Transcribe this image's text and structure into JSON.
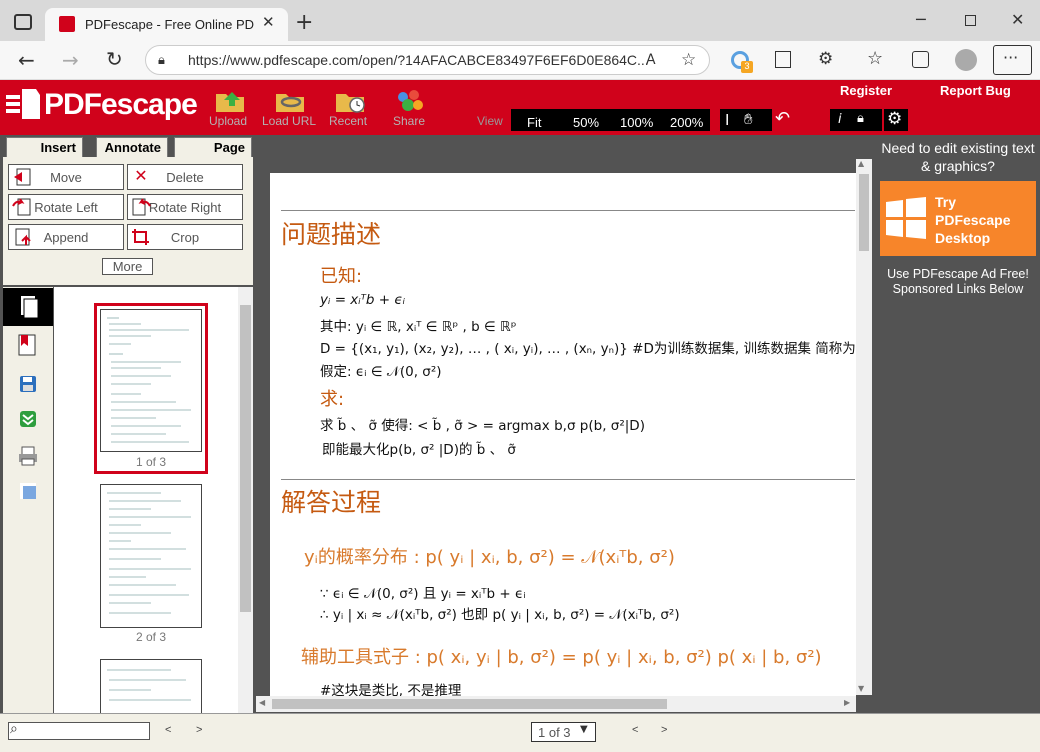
{
  "browser": {
    "tab_title": "PDFescape - Free Online PDF Edi",
    "url": "https://www.pdfescape.com/open/?14AFACABCE83497F6EF6D0E864C...",
    "extension_badge": "3"
  },
  "app": {
    "logo": "PDFescape",
    "toolbar": [
      "Upload",
      "Load URL",
      "Recent",
      "Share"
    ],
    "view_label": "View",
    "zoom_options": [
      "Fit",
      "50%",
      "100%",
      "200%"
    ],
    "register": "Register",
    "report_bug": "Report Bug",
    "info_glyph": "i"
  },
  "left": {
    "tabs": [
      "Insert",
      "Annotate",
      "Page"
    ],
    "page_tools": [
      "Move",
      "Delete",
      "Rotate Left",
      "Rotate Right",
      "Append",
      "Crop"
    ],
    "more": "More",
    "thumb_labels": [
      "1 of 3",
      "2 of 3"
    ]
  },
  "right": {
    "promo_text": "Need to edit existing text & graphics?",
    "cta": "Try PDFescape Desktop",
    "ad_note": "Use PDFescape Ad Free! Sponsored Links Below"
  },
  "bottom": {
    "prev": "<",
    "next": ">",
    "page_select": "1 of 3",
    "prev2": "<",
    "next2": ">"
  },
  "doc": {
    "h_problem": "问题描述",
    "known": "已知:",
    "l1": "yᵢ =  xᵢᵀb + ϵᵢ",
    "l2": "其中: yᵢ ∈ ℝ,  xᵢᵀ ∈ ℝᵖ , b ∈ ℝᵖ",
    "l3": "D = {(x₁, y₁), (x₂, y₂), … , ( xᵢ, yᵢ), … , (xₙ, yₙ)}    #D为训练数据集, 训练数据集 简称为 训",
    "l4": "假定: ϵᵢ ∈ 𝒩(0, σ²)",
    "seek": "求:",
    "l5": "求 b̃  、 σ̃  使得: < b̃ , σ̃ > = argmax b,σ p(b, σ²|D)",
    "l6": "即能最大化p(b, σ² |D)的 b̃  、 σ̃",
    "h_solution": "解答过程",
    "s1": "yᵢ的概率分布 :  p( yᵢ | xᵢ, b, σ²) = 𝒩(xᵢᵀb, σ²)",
    "l7": "∵ ϵᵢ ∈ 𝒩(0, σ²) 且 yᵢ =  xᵢᵀb + ϵᵢ",
    "l8": "∴ yᵢ | xᵢ ≈ 𝒩(xᵢᵀb, σ²) 也即  p( yᵢ | xᵢ, b, σ²) = 𝒩(xᵢᵀb, σ²)",
    "s2": "辅助工具式子 : p( xᵢ, yᵢ  | b, σ²) = p( yᵢ  | xᵢ, b, σ²)  p( xᵢ |  b, σ²)",
    "l9": "#这块是类比, 不是推理"
  }
}
